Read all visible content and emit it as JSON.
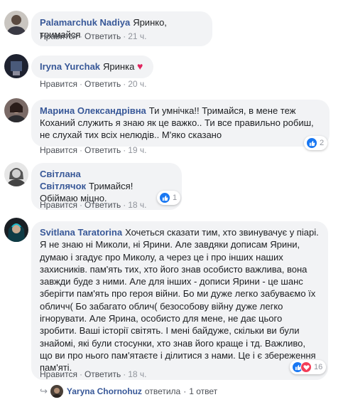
{
  "comments": [
    {
      "author": "Palamarchuk Nadiya",
      "text": "Яринко, тримайся",
      "like_label": "Нравится",
      "reply_label": "Ответить",
      "time": "21 ч."
    },
    {
      "author": "Iryna Yurchak",
      "text": "Яринка",
      "heart": "♥",
      "like_label": "Нравится",
      "reply_label": "Ответить",
      "time": "20 ч."
    },
    {
      "author": "Марина Олександрівна",
      "text": "Ти умнічка!! Тримайся, в мене теж Коханий служить я знаю як це важко.. Ти все правильно робиш, не слухай тих всіх нелюдів.. М'яко сказано",
      "like_label": "Нравится",
      "reply_label": "Ответить",
      "time": "19 ч.",
      "reaction_count": "2"
    },
    {
      "author": "Світлана Світлячок",
      "text": "Тримайся! Обіймаю міцно.",
      "like_label": "Нравится",
      "reply_label": "Ответить",
      "time": "18 ч.",
      "reaction_count": "1"
    },
    {
      "author": "Svitlana Taratorina",
      "text": "Хочеться сказати тим, хто звинувачує у піарі. Я не знаю ні Миколи, ні Ярини. Але завдяки дописам Ярини, думаю і згадує про Миколу, а через це і про інших наших захисників. пам'ять тих, хто його знав особисто важлива, вона завжди буде з ними. Але для інших - дописи Ярини - це шанс зберігти пам'ять про героя війни. Бо ми дуже легко забуваємо їх обличч( Бо забагато облич( безособову війну дуже легко ігнорувати. Але Ярина, особисто для мене, не дає цього зробити. Ваші історії світять. І мені байдуже, скільки ви були знайомі, які були стосунки, хто знав його краще і тд. Важливо, що ви про нього пам'ятаєте і ділитися з нами. Це і є збереження пам'яті.",
      "like_label": "Нравится",
      "reply_label": "Ответить",
      "time": "18 ч.",
      "reaction_count": "16"
    }
  ],
  "reply_summary": {
    "author": "Yaryna Chornohuz",
    "action": "ответила",
    "separator": "·",
    "count": "1 ответ"
  },
  "separator": "·",
  "colors": {
    "bubble": "#f2f3f5",
    "author": "#385898",
    "meta": "#90949c",
    "like_blue": "#1877f2",
    "love_red": "#f33e58"
  }
}
